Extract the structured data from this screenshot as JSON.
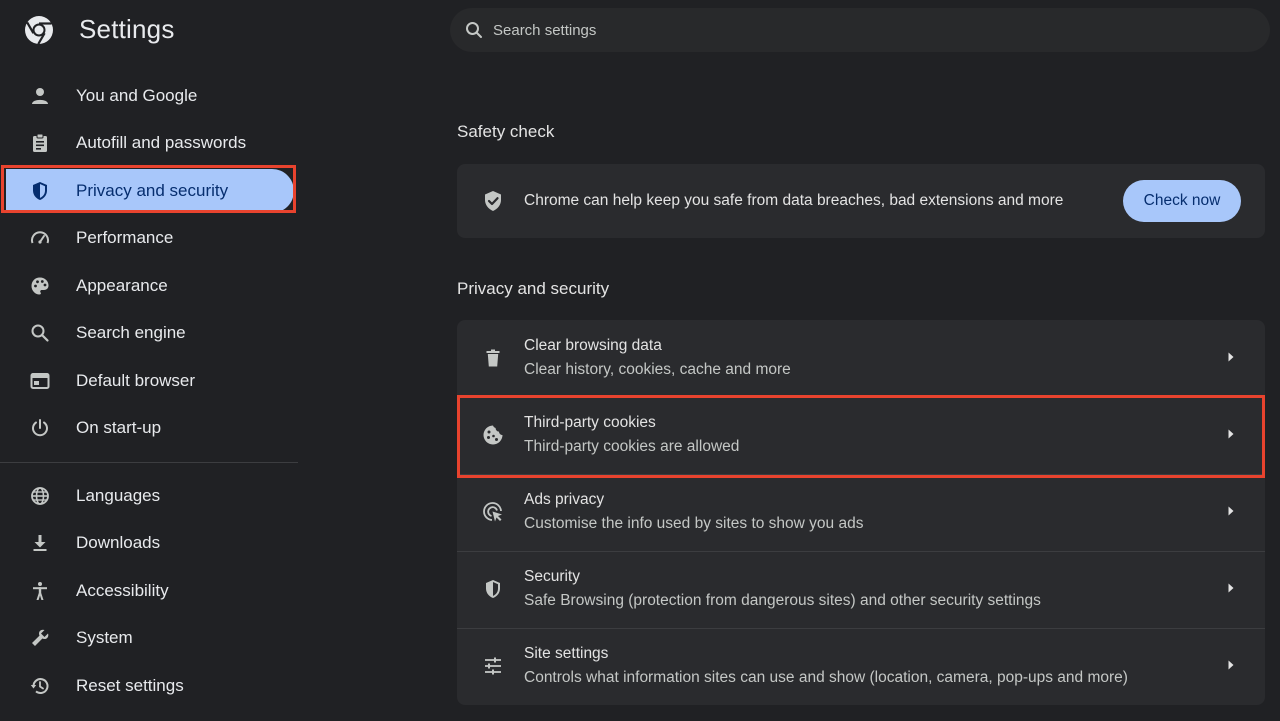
{
  "header": {
    "title": "Settings",
    "search_placeholder": "Search settings"
  },
  "sidebar": {
    "items": [
      {
        "label": "You and Google",
        "icon": "person-icon"
      },
      {
        "label": "Autofill and passwords",
        "icon": "clipboard-icon"
      },
      {
        "label": "Privacy and security",
        "icon": "shield-icon",
        "active": true
      },
      {
        "label": "Performance",
        "icon": "speedometer-icon"
      },
      {
        "label": "Appearance",
        "icon": "palette-icon"
      },
      {
        "label": "Search engine",
        "icon": "search-icon"
      },
      {
        "label": "Default browser",
        "icon": "browser-window-icon"
      },
      {
        "label": "On start-up",
        "icon": "power-icon"
      },
      {
        "label": "Languages",
        "icon": "globe-icon"
      },
      {
        "label": "Downloads",
        "icon": "download-icon"
      },
      {
        "label": "Accessibility",
        "icon": "accessibility-icon"
      },
      {
        "label": "System",
        "icon": "wrench-icon"
      },
      {
        "label": "Reset settings",
        "icon": "history-icon"
      }
    ]
  },
  "main": {
    "safety_check": {
      "title": "Safety check",
      "text": "Chrome can help keep you safe from data breaches, bad extensions and more",
      "button": "Check now"
    },
    "privacy": {
      "title": "Privacy and security",
      "rows": [
        {
          "title": "Clear browsing data",
          "subtitle": "Clear history, cookies, cache and more",
          "icon": "trash-icon"
        },
        {
          "title": "Third-party cookies",
          "subtitle": "Third-party cookies are allowed",
          "icon": "cookie-icon"
        },
        {
          "title": "Ads privacy",
          "subtitle": "Customise the info used by sites to show you ads",
          "icon": "ads-target-icon"
        },
        {
          "title": "Security",
          "subtitle": "Safe Browsing (protection from dangerous sites) and other security settings",
          "icon": "shield-icon"
        },
        {
          "title": "Site settings",
          "subtitle": "Controls what information sites can use and show (location, camera, pop-ups and more)",
          "icon": "sliders-icon"
        }
      ]
    }
  },
  "colors": {
    "background": "#202124",
    "card": "#2a2b2e",
    "accent": "#a8c7fa",
    "accent_text": "#062e6f",
    "highlight_border": "#e8432e"
  }
}
